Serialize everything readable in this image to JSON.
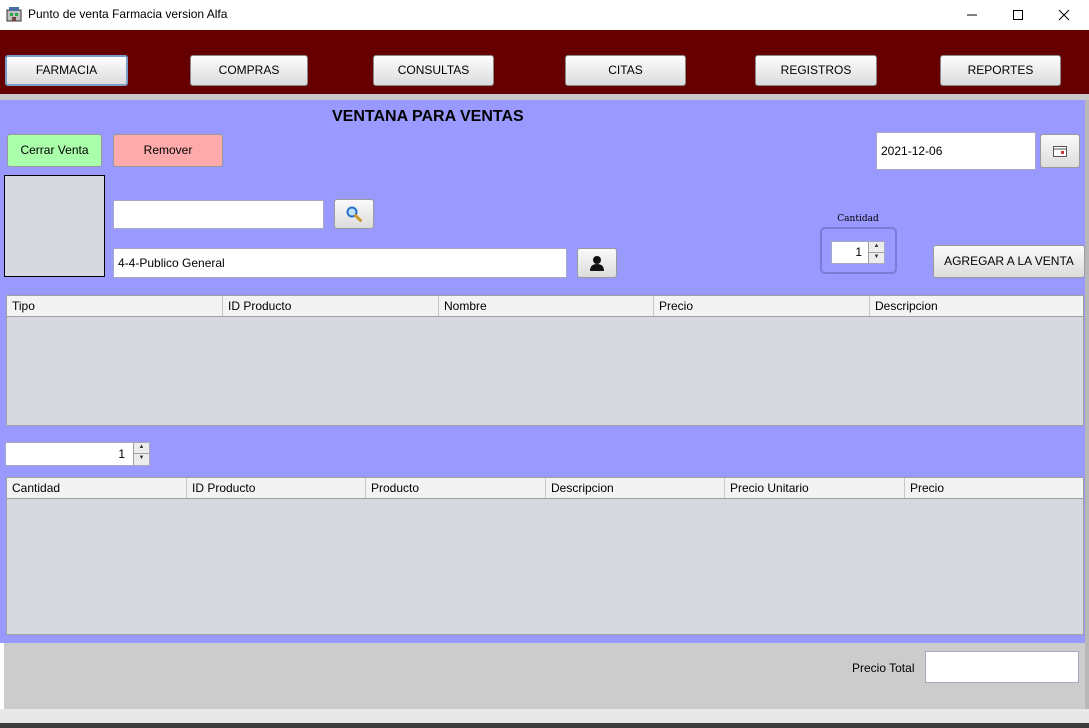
{
  "window": {
    "title": "Punto de venta Farmacia  version Alfa",
    "app_icon": "pharmacy-icon"
  },
  "menu": {
    "items": [
      {
        "label": "FARMACIA",
        "active": true
      },
      {
        "label": "COMPRAS"
      },
      {
        "label": "CONSULTAS"
      },
      {
        "label": "CITAS"
      },
      {
        "label": "REGISTROS"
      },
      {
        "label": "REPORTES"
      }
    ]
  },
  "sales": {
    "heading": "VENTANA PARA VENTAS",
    "close_sale_label": "Cerrar Venta",
    "remove_label": "Remover",
    "date_value": "2021-12-06",
    "search_value": "",
    "customer_value": "4-4-Publico General",
    "quantity_label": "Cantidad",
    "quantity_value": "1",
    "add_label": "AGREGAR A LA VENTA",
    "lower_quantity_value": "1",
    "total_label": "Precio Total",
    "total_value": ""
  },
  "products_table": {
    "columns": [
      "Tipo",
      "ID Producto",
      "Nombre",
      "Precio",
      "Descripcion"
    ]
  },
  "sale_table": {
    "columns": [
      "Cantidad",
      "ID Producto",
      "Producto",
      "Descripcion",
      "Precio Unitario",
      "Precio"
    ]
  },
  "colors": {
    "menubar": "#660000",
    "content": "#9999ff",
    "close_sale": "#aaffaa",
    "remove": "#ffaaaa"
  }
}
